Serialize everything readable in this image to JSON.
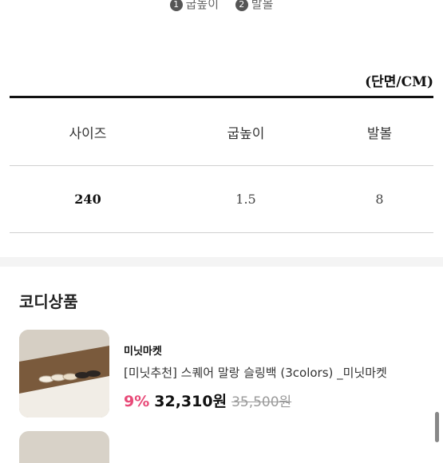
{
  "legend": {
    "items": [
      {
        "num": "1",
        "label": "굽높이"
      },
      {
        "num": "2",
        "label": "발볼"
      }
    ]
  },
  "size_table": {
    "unit": "(단면/CM)",
    "headers": [
      "사이즈",
      "굽높이",
      "발볼"
    ],
    "rows": [
      [
        "240",
        "1.5",
        "8"
      ]
    ]
  },
  "coordi": {
    "title": "코디상품",
    "products": [
      {
        "brand": "미닛마켓",
        "name": "[미닛추천] 스퀘어 말랑 슬링백 (3colors) _미닛마켓",
        "discount": "9%",
        "price": "32,310원",
        "original_price": "35,500원",
        "thumbnail_icon": "shoes-product-photo"
      }
    ]
  },
  "colors": {
    "discount": "#e84a78",
    "table_rule": "#111111",
    "divider": "#d0d0d0"
  }
}
